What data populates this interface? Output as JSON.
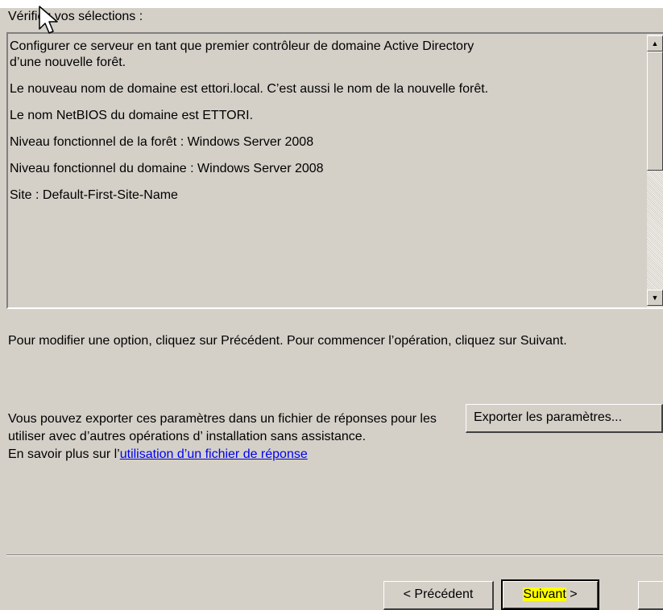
{
  "dialog": {
    "heading": "Vérifiez vos sélections :",
    "summary_lines": [
      "Configurer ce serveur en tant que premier contrôleur de domaine Active Directory",
      "d’une nouvelle forêt.",
      "Le nouveau nom de domaine est ettori.local. C’est aussi le nom de la nouvelle forêt.",
      "Le nom NetBIOS du domaine est ETTORI.",
      "Niveau fonctionnel de la forêt : Windows Server 2008",
      "Niveau fonctionnel du domaine : Windows Server 2008",
      "Site : Default-First-Site-Name"
    ],
    "instructions": "Pour modifier une option, cliquez sur Précédent. Pour commencer l’opération, cliquez sur Suivant.",
    "export_text": "Vous pouvez exporter ces paramètres dans un fichier de réponses pour les utiliser avec d’autres opérations d’ installation sans assistance.",
    "learn_more_prefix": "En savoir plus sur l’",
    "learn_more_link": "utilisation d’un fichier de réponse",
    "export_button": "Exporter les paramètres...",
    "prev_button": "< Précédent",
    "next_button_label": "Suivant",
    "next_button_arrow": " >",
    "scroll_up_icon": "▲",
    "scroll_down_icon": "▼"
  },
  "colors": {
    "dialog_bg": "#d4d0c8",
    "link": "#0000ee",
    "highlight": "#ffff00"
  }
}
